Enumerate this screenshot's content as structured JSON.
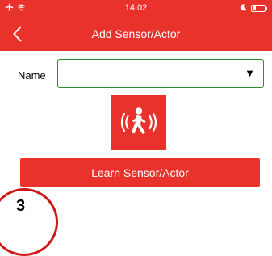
{
  "status_bar": {
    "time": "14:02"
  },
  "header": {
    "title": "Add Sensor/Actor",
    "back_icon": "chevron-left-icon"
  },
  "form": {
    "name_label": "Name",
    "name_value": "",
    "dropdown_icon": "triangle-down-icon",
    "dropdown_glyph": "▼"
  },
  "sensor_icon": "motion-sensor-icon",
  "actions": {
    "learn_label": "Learn Sensor/Actor"
  },
  "step": {
    "number": "3"
  },
  "colors": {
    "accent": "#e8322b",
    "field_border": "#2e8b2e",
    "step_ring": "#d01818"
  }
}
